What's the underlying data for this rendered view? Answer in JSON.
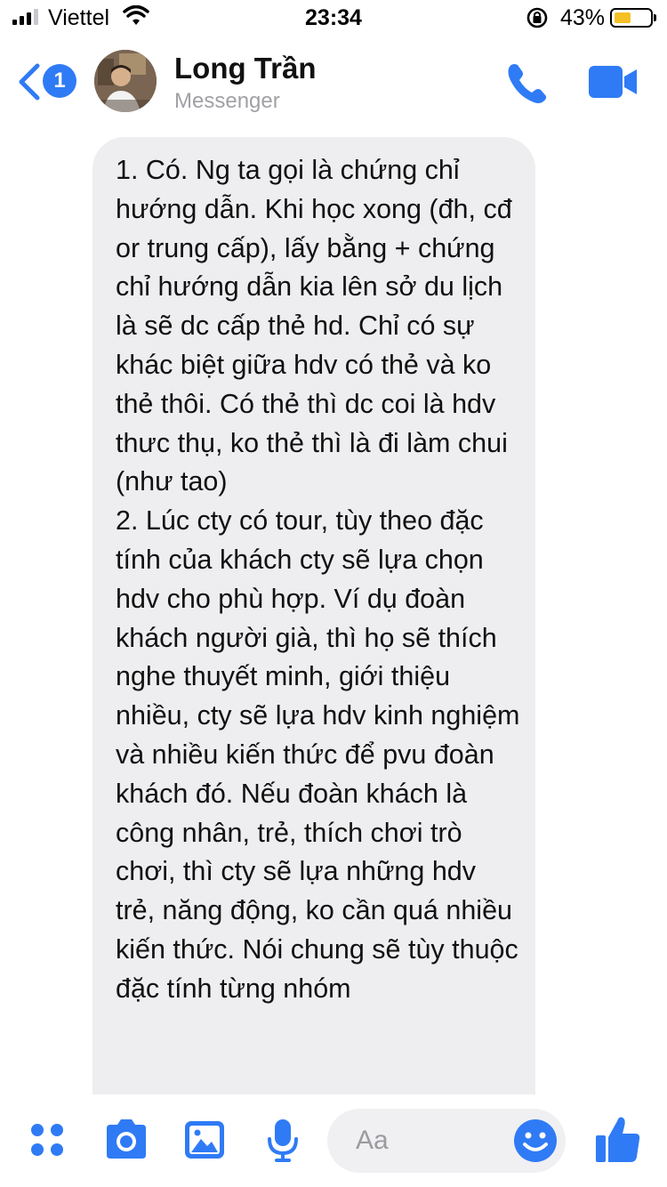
{
  "status_bar": {
    "carrier": "Viettel",
    "time": "23:34",
    "battery_percent": "43%",
    "battery_level": 0.43,
    "battery_color": "#f4c025"
  },
  "header": {
    "unread_count": "1",
    "contact_name": "Long Trần",
    "subtitle": "Messenger",
    "icons": [
      "chevron-left-icon",
      "phone-icon",
      "video-camera-icon"
    ],
    "accent_color": "#2f7bf5"
  },
  "conversation": {
    "message": "1. Có. Ng ta gọi là chứng chỉ hướng dẫn. Khi học xong (đh, cđ or trung cấp), lấy bằng + chứng chỉ hướng dẫn kia lên sở du lịch là sẽ dc cấp thẻ hd. Chỉ có sự khác biệt giữa hdv có thẻ và ko thẻ thôi. Có thẻ thì dc coi là hdv thưc thụ, ko thẻ thì là đi làm chui (như tao)\n2. Lúc cty có tour, tùy theo đặc tính của khách cty sẽ lựa chọn hdv cho phù hợp. Ví dụ đoàn khách người già, thì họ sẽ thích nghe thuyết minh, giới thiệu nhiều, cty sẽ lựa hdv kinh nghiệm và nhiều kiến thức để pvu đoàn khách đó. Nếu đoàn khách là công nhân, trẻ, thích chơi trò chơi, thì cty sẽ lựa những hdv trẻ, năng động, ko cần quá nhiều kiến thức. Nói chung sẽ tùy thuộc đặc tính từng nhóm"
  },
  "composer": {
    "placeholder": "Aa",
    "icons": [
      "apps-grid-icon",
      "camera-icon",
      "gallery-icon",
      "microphone-icon",
      "emoji-icon",
      "thumbs-up-icon"
    ]
  }
}
